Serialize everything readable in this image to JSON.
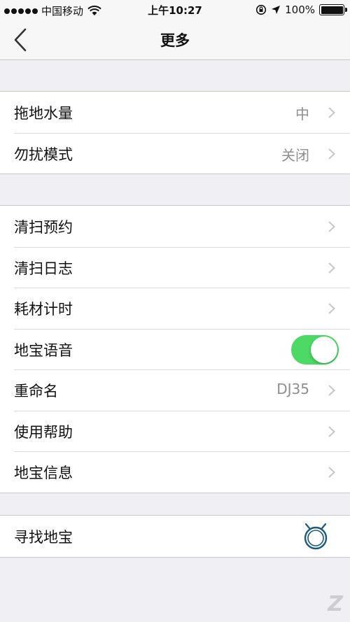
{
  "status_bar": {
    "carrier": "中国移动",
    "time": "上午10:27",
    "battery": "100%",
    "icons": [
      "signal-dots-icon",
      "wifi-icon",
      "orientation-lock-icon",
      "location-arrow-icon",
      "battery-icon"
    ]
  },
  "nav": {
    "title": "更多",
    "back_icon": "chevron-left-icon"
  },
  "groups": [
    {
      "rows": [
        {
          "label": "拖地水量",
          "value": "中",
          "accessory": "chevron-right-icon"
        },
        {
          "label": "勿扰模式",
          "value": "关闭",
          "accessory": "chevron-right-icon"
        }
      ]
    },
    {
      "rows": [
        {
          "label": "清扫预约",
          "value": "",
          "accessory": "chevron-right-icon"
        },
        {
          "label": "清扫日志",
          "value": "",
          "accessory": "chevron-right-icon"
        },
        {
          "label": "耗材计时",
          "value": "",
          "accessory": "chevron-right-icon"
        },
        {
          "label": "地宝语音",
          "value": "",
          "accessory": "toggle",
          "toggle_on": true
        },
        {
          "label": "重命名",
          "value": "DJ35",
          "accessory": "chevron-right-icon"
        },
        {
          "label": "使用帮助",
          "value": "",
          "accessory": "chevron-right-icon"
        },
        {
          "label": "地宝信息",
          "value": "",
          "accessory": "chevron-right-icon"
        }
      ]
    },
    {
      "rows": [
        {
          "label": "寻找地宝",
          "value": "",
          "accessory": "robot-icon"
        }
      ]
    }
  ],
  "colors": {
    "background": "#efeff4",
    "toggle_on": "#4cd964",
    "robot_icon": "#1a5a7a",
    "secondary_text": "#8e8e93"
  }
}
